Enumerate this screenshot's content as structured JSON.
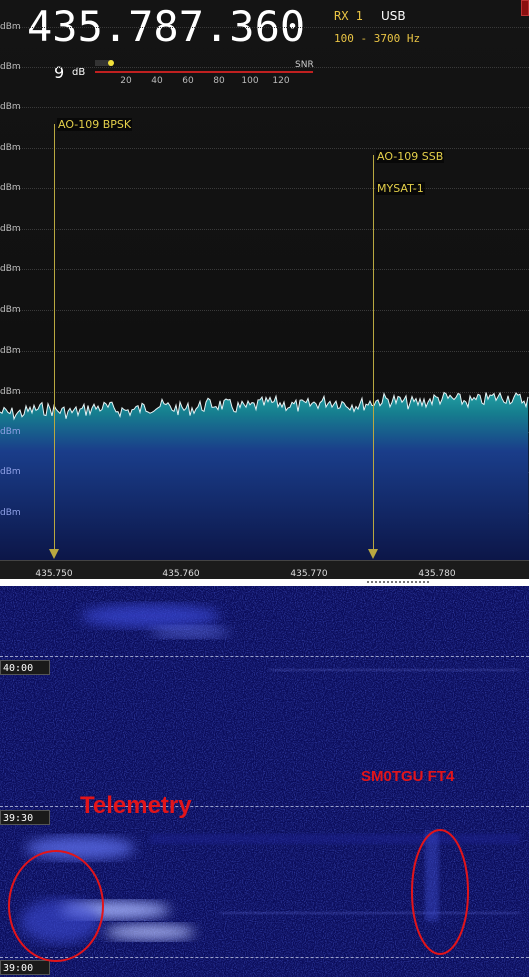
{
  "readout": {
    "frequency": "435.787.360",
    "receiver": "RX 1",
    "mode": "USB",
    "bandwidth": "100 - 3700 Hz"
  },
  "snr": {
    "value": "9",
    "unit": "dB",
    "label": "SNR",
    "scale": [
      "20",
      "40",
      "60",
      "80",
      "100",
      "120"
    ]
  },
  "dbm_labels": [
    "dBm",
    "dBm",
    "dBm",
    "dBm",
    "dBm",
    "dBm",
    "dBm",
    "dBm",
    "dBm",
    "dBm",
    "dBm",
    "dBm",
    "dBm"
  ],
  "markers": [
    {
      "label": "AO-109 BPSK"
    },
    {
      "label": "AO-109 SSB"
    },
    {
      "label": "MYSAT-1"
    }
  ],
  "freq_axis": [
    "435.750",
    "435.760",
    "435.770",
    "435.780"
  ],
  "waterfall": {
    "times": [
      "40:00",
      "39:30",
      "39:00"
    ]
  },
  "annotations": {
    "telemetry": "Telemetry",
    "ft4": "SM0TGU FT4"
  },
  "colors": {
    "marker": "#e3cf4a",
    "spectrum_fill": "#1f8f95",
    "waterfall_bg": "#0a0c55",
    "annotation": "#e2141a"
  }
}
